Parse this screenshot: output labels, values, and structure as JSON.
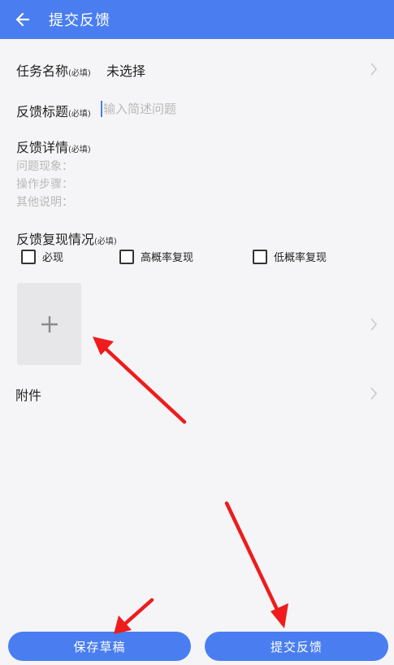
{
  "appbar": {
    "title": "提交反馈"
  },
  "form": {
    "task": {
      "label": "任务名称",
      "required": "(必填)",
      "value": "未选择"
    },
    "title": {
      "label": "反馈标题",
      "required": "(必填)",
      "placeholder": "输入简述问题"
    },
    "detail": {
      "label": "反馈详情",
      "required": "(必填)",
      "hints": [
        "问题现象：",
        "操作步骤：",
        "其他说明："
      ]
    },
    "repro": {
      "label": "反馈复现情况",
      "required": "(必填)",
      "options": [
        {
          "label": "必现",
          "checked": false
        },
        {
          "label": "高概率复现",
          "checked": false
        },
        {
          "label": "低概率复现",
          "checked": false
        }
      ]
    },
    "attachment": {
      "label": "附件"
    }
  },
  "buttons": {
    "save_draft": "保存草稿",
    "submit": "提交反馈"
  },
  "colors": {
    "primary": "#4a7ef0",
    "annotation": "#ee1c1c"
  },
  "icons": {
    "back": "arrow-left-icon",
    "chevron": "chevron-right-icon",
    "add": "plus-icon",
    "checkbox": "checkbox-unchecked-icon"
  }
}
